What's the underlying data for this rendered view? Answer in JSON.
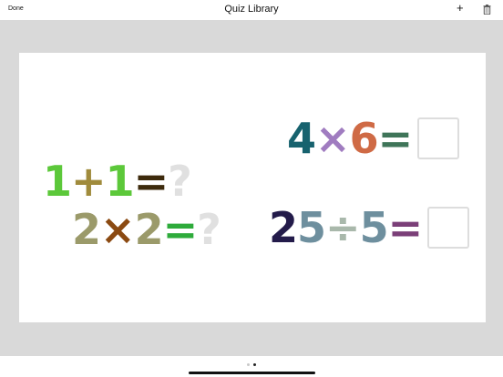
{
  "navbar": {
    "done_label": "Done",
    "title": "Quiz Library",
    "add_label": "+",
    "add_icon": "plus-icon",
    "delete_icon": "trash-icon"
  },
  "quiz": {
    "eq1": {
      "a": "1",
      "op": "+",
      "b": "1",
      "eq": "=",
      "ans": "?",
      "colors": {
        "a": "#5cc83a",
        "op": "#a08b3c",
        "b": "#5cc83a",
        "eq": "#3d2a0c",
        "ans": "#e0e0e0"
      }
    },
    "eq2": {
      "a": "2",
      "op": "×",
      "b": "2",
      "eq": "=",
      "ans": "?",
      "colors": {
        "a": "#9b9a6a",
        "op": "#8b4a12",
        "b": "#9b9a6a",
        "eq": "#2eab3b",
        "ans": "#e0e0e0"
      }
    },
    "eq3": {
      "a": "4",
      "op": "×",
      "b": "6",
      "eq": "=",
      "colors": {
        "a": "#17626e",
        "op": "#a07cc0",
        "b": "#cf6a45",
        "eq": "#3f7559"
      }
    },
    "eq4": {
      "a1": "2",
      "a2": "5",
      "op": "÷",
      "b": "5",
      "eq": "=",
      "colors": {
        "a1": "#231b4a",
        "a2": "#6e8f9e",
        "op": "#a9b8ab",
        "b": "#6e8f9e",
        "eq": "#7b3f78"
      }
    }
  },
  "pager": {
    "pages": 2,
    "current": 2
  }
}
